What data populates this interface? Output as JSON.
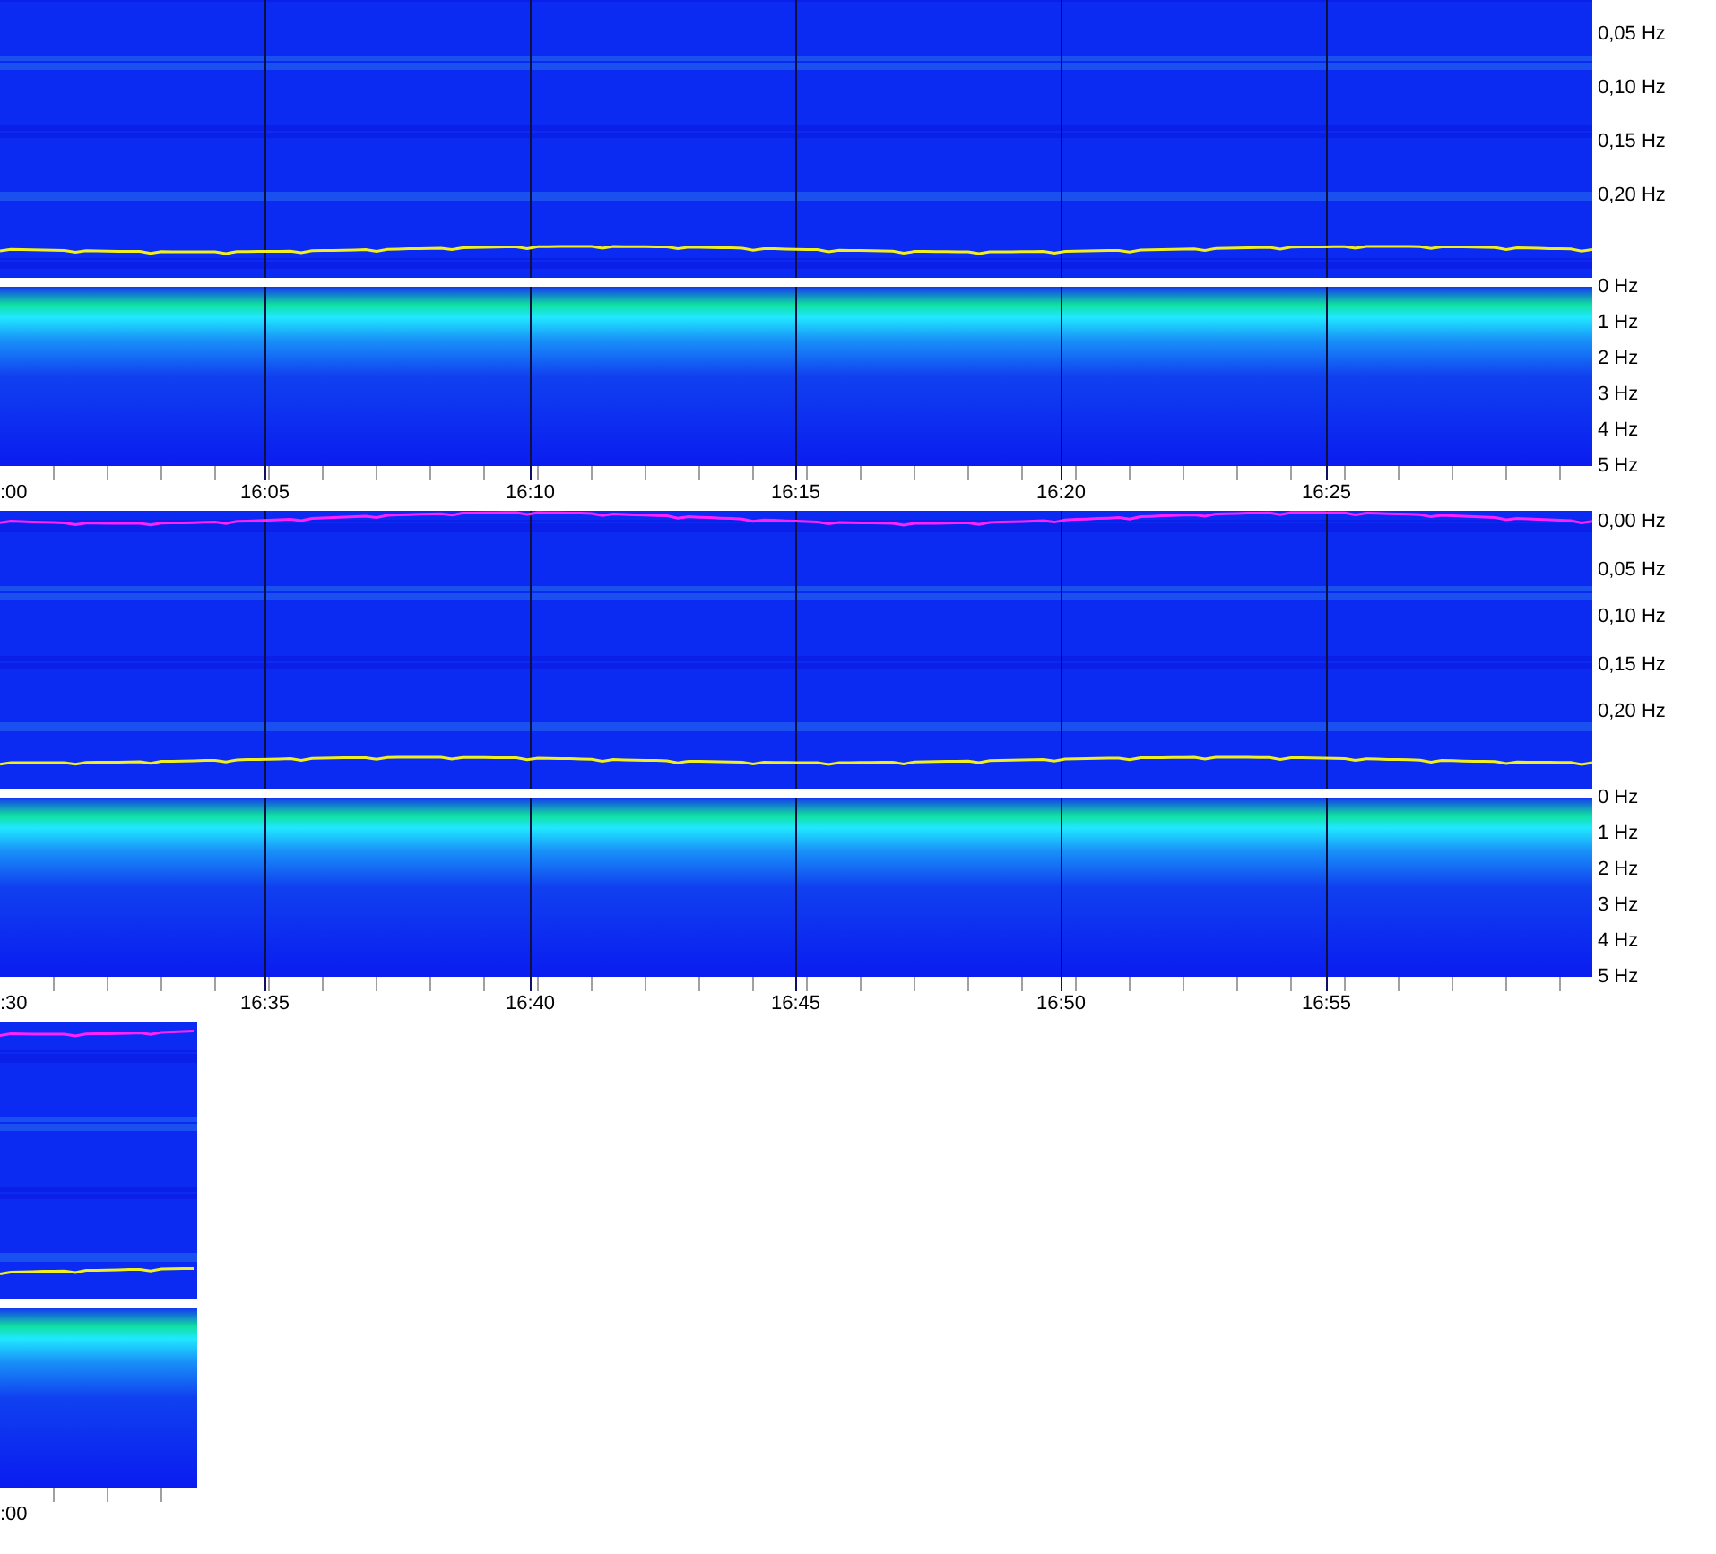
{
  "strips": [
    {
      "low_band_labels": [
        "0,05 Hz",
        "0,10 Hz",
        "0,15 Hz",
        "0,20 Hz"
      ],
      "high_band_labels": [
        "0 Hz",
        "1 Hz",
        "2 Hz",
        "3 Hz",
        "4 Hz",
        "5 Hz"
      ],
      "time_labels": [
        ":00",
        "16:05",
        "16:10",
        "16:15",
        "16:20",
        "16:25"
      ]
    },
    {
      "low_band_labels": [
        "0,00 Hz",
        "0,05 Hz",
        "0,10 Hz",
        "0,15 Hz",
        "0,20 Hz"
      ],
      "high_band_labels": [
        "0 Hz",
        "1 Hz",
        "2 Hz",
        "3 Hz",
        "4 Hz",
        "5 Hz"
      ],
      "time_labels": [
        ":30",
        "16:35",
        "16:40",
        "16:45",
        "16:50",
        "16:55"
      ]
    },
    {
      "time_labels": [
        ":00"
      ]
    }
  ]
}
